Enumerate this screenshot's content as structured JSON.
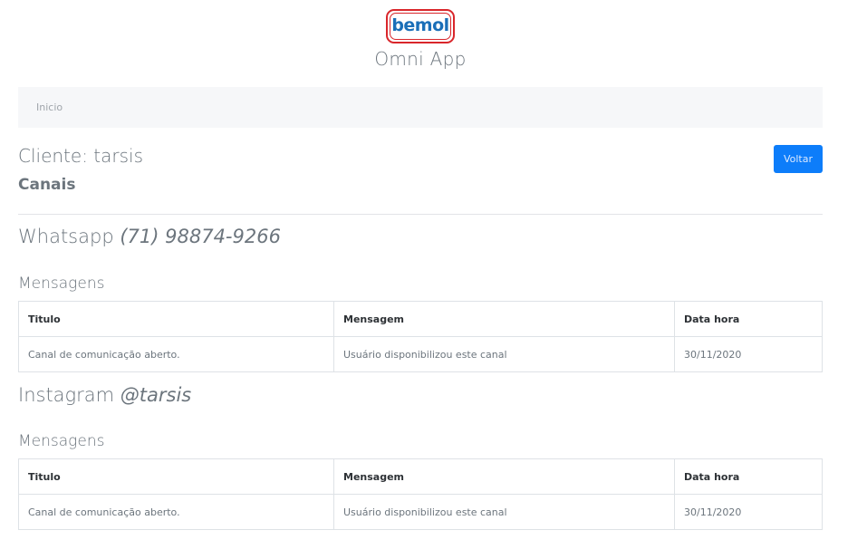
{
  "header": {
    "logo_text": "bemol",
    "app_title": "Omni App"
  },
  "breadcrumb": {
    "home": "Inicio"
  },
  "client": {
    "title": "Cliente: tarsis",
    "subtitle": "Canais",
    "back_label": "Voltar"
  },
  "colors": {
    "primary": "#0d7dfa",
    "logo_red": "#d9262b",
    "logo_blue": "#1b6fb8"
  },
  "channels": [
    {
      "name": "Whatsapp",
      "handle": "(71) 98874-9266",
      "messages_title": "Mensagens",
      "headers": [
        "Titulo",
        "Mensagem",
        "Data hora"
      ],
      "rows": [
        [
          "Canal de comunicação aberto.",
          "Usuário disponibilizou este canal",
          "30/11/2020"
        ]
      ]
    },
    {
      "name": "Instagram",
      "handle": "@tarsis",
      "messages_title": "Mensagens",
      "headers": [
        "Titulo",
        "Mensagem",
        "Data hora"
      ],
      "rows": [
        [
          "Canal de comunicação aberto.",
          "Usuário disponibilizou este canal",
          "30/11/2020"
        ]
      ]
    }
  ]
}
